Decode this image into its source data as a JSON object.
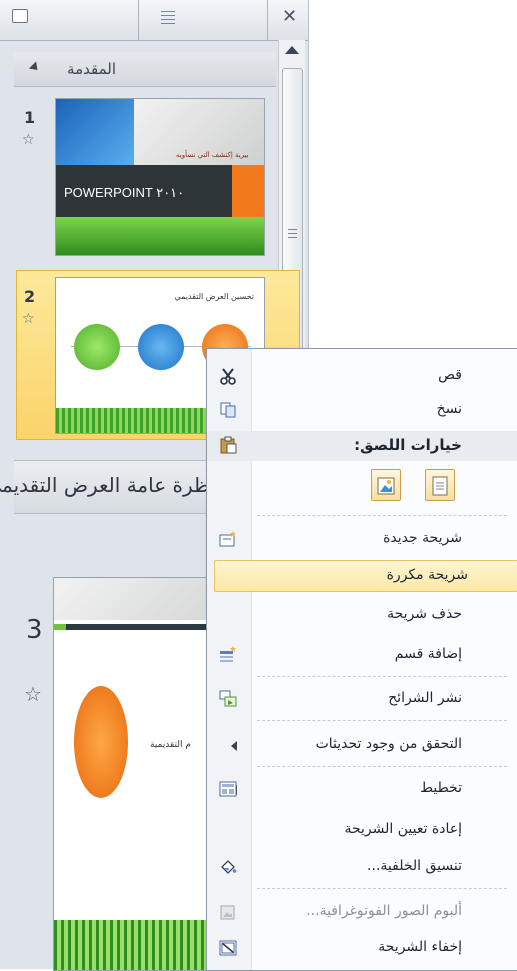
{
  "pane": {
    "section1_title": "المقدمة",
    "section2_title": "نظرة عامة العرض التقديمي",
    "slides": [
      {
        "number": "1",
        "title_text": "POWERPOINT ٢٠١٠",
        "subtitle_text": "بيرية إكتشف التي نسأويه"
      },
      {
        "number": "2",
        "title_text": "تحسين العرض التقديمي"
      },
      {
        "number": "3",
        "label_text": "م التقديمية"
      }
    ]
  },
  "menu": {
    "cut": "قص",
    "copy": "نسخ",
    "paste_options": "خيارات اللصق:",
    "new_slide": "شريحة جديدة",
    "duplicate_slide": "شريحة مكررة",
    "delete_slide": "حذف شريحة",
    "add_section": "إضافة قسم",
    "publish_slides": "نشر الشرائح",
    "check_updates": "التحقق من وجود تحديثات",
    "layout": "تخطيط",
    "reset_slide": "إعادة تعيين الشريحة",
    "format_background": "تنسيق الخلفية...",
    "photo_album": "ألبوم الصور الفوتوغرافية...",
    "hide_slide": "إخفاء الشريحة"
  },
  "colors": {
    "selection": "#fbd46a",
    "highlight": "#fbe8a6",
    "accent_orange": "#f27a1c",
    "accent_green": "#6ec43b"
  }
}
